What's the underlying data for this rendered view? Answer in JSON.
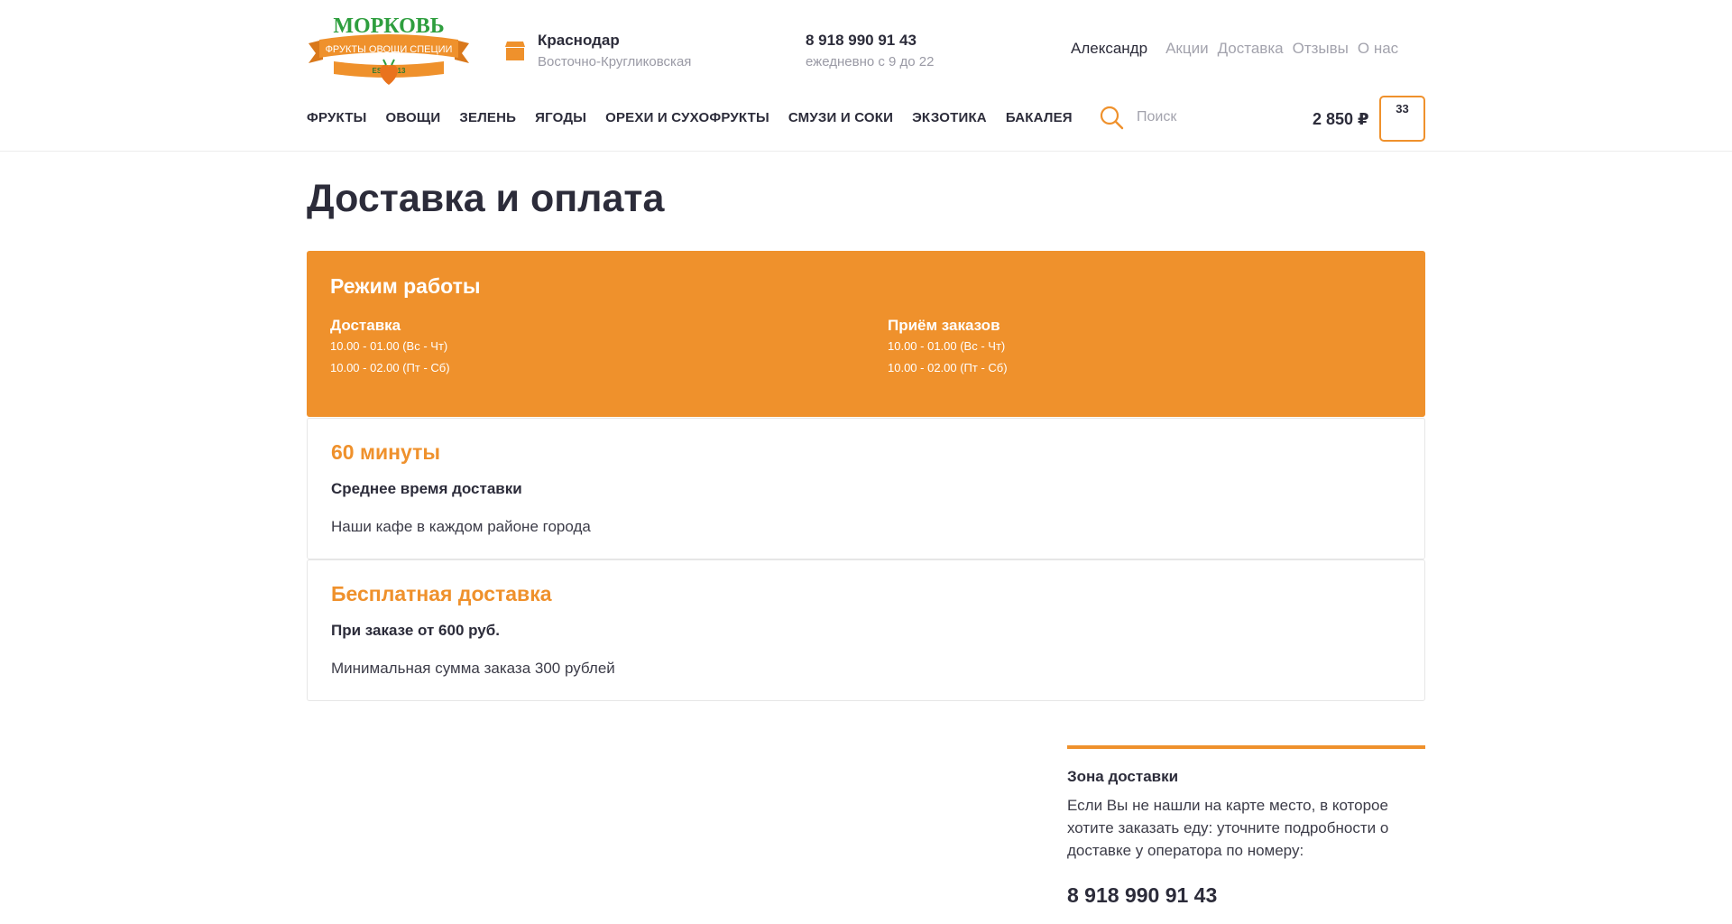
{
  "logo": {
    "brand": "МОРКОВЬ",
    "tagline": "ФРУКТЫ ОВОЩИ СПЕЦИИ",
    "est": "EST. 2013"
  },
  "location": {
    "icon": "shop-icon",
    "city": "Краснодар",
    "district": "Восточно-Кругликовская"
  },
  "contact": {
    "phone": "8 918 990 91 43",
    "hours": "ежедневно с 9 до 22"
  },
  "top_links": {
    "user": "Александр",
    "items": [
      "Акции",
      "Доставка",
      "Отзывы",
      "О нас"
    ]
  },
  "nav": {
    "items": [
      "ФРУКТЫ",
      "ОВОЩИ",
      "ЗЕЛЕНЬ",
      "ЯГОДЫ",
      "ОРЕХИ И СУХОФРУКТЫ",
      "СМУЗИ И СОКИ",
      "ЭКЗОТИКА",
      "БАКАЛЕЯ"
    ]
  },
  "search": {
    "placeholder": "Поиск",
    "icon": "search-icon"
  },
  "cart": {
    "total": "2 850 ₽",
    "count": "33"
  },
  "page": {
    "title": "Доставка и оплата"
  },
  "working_hours": {
    "title": "Режим работы",
    "delivery": {
      "title": "Доставка",
      "lines": [
        "10.00 - 01.00 (Вс - Чт)",
        "10.00 - 02.00 (Пт - Сб)"
      ]
    },
    "orders": {
      "title": "Приём заказов",
      "lines": [
        "10.00 - 01.00 (Вс - Чт)",
        "10.00 - 02.00 (Пт - Сб)"
      ]
    }
  },
  "cards": [
    {
      "title": "60 минуты",
      "subtitle": "Среднее время доставки",
      "text": "Наши кафе в каждом районе города"
    },
    {
      "title": "Бесплатная доставка",
      "subtitle": "При заказе от 600 руб.",
      "text": "Минимальная сумма заказа 300 рублей"
    }
  ],
  "zone": {
    "title": "Зона доставки",
    "text": "Если Вы не нашли на карте место, в которое хотите заказать еду: уточните подробности о доставке у оператора по номеру:",
    "phone": "8 918 990 91 43"
  },
  "colors": {
    "accent": "#ef912c",
    "brand_green": "#2e9e3e",
    "text": "#2c2c3a",
    "muted": "#a3a3ad"
  }
}
